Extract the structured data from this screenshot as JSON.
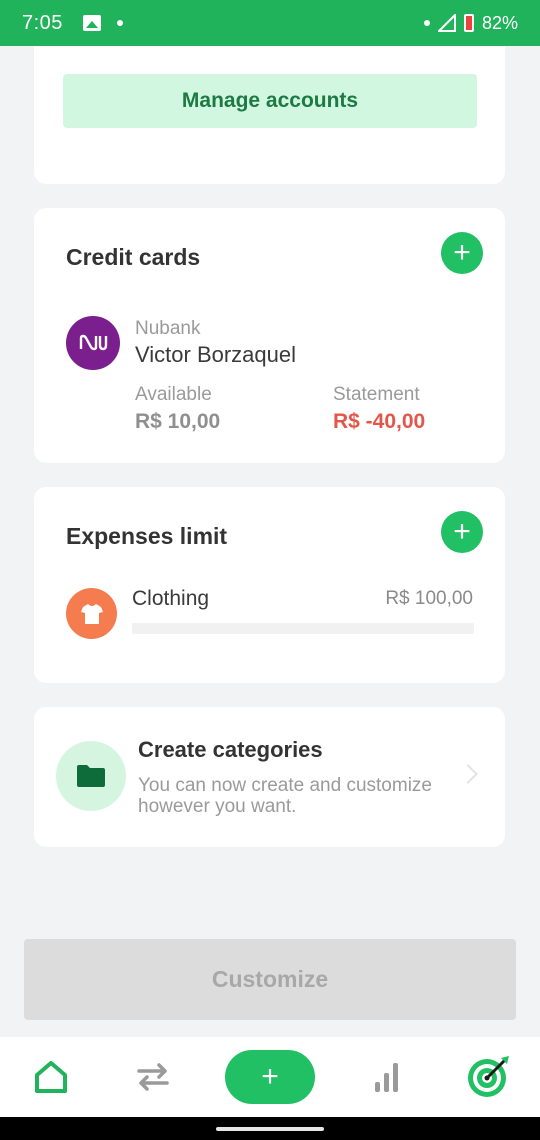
{
  "status_bar": {
    "time": "7:05",
    "battery": "82%"
  },
  "accounts_card": {
    "manage_label": "Manage accounts"
  },
  "credit_cards": {
    "title": "Credit cards",
    "add_label": "+",
    "card": {
      "bank": "Nubank",
      "holder": "Victor Borzaquel",
      "available_label": "Available",
      "available_value": "R$ 10,00",
      "statement_label": "Statement",
      "statement_value": "R$ -40,00"
    }
  },
  "expenses_limit": {
    "title": "Expenses limit",
    "add_label": "+",
    "item": {
      "name": "Clothing",
      "value": "R$ 100,00",
      "progress": 0
    }
  },
  "categories_promo": {
    "title": "Create categories",
    "description": "You can now create and customize however you want."
  },
  "customize_label": "Customize",
  "bottom_nav": {
    "add_label": "+",
    "items": [
      "home-icon",
      "transfer-icon",
      "add-icon",
      "chart-icon",
      "target-icon"
    ]
  },
  "colors": {
    "brand_green": "#21c064",
    "status_green": "#21b35b",
    "negative": "#e4564a",
    "nubank_purple": "#7b1e8e",
    "clothing_orange": "#f47c4f"
  }
}
